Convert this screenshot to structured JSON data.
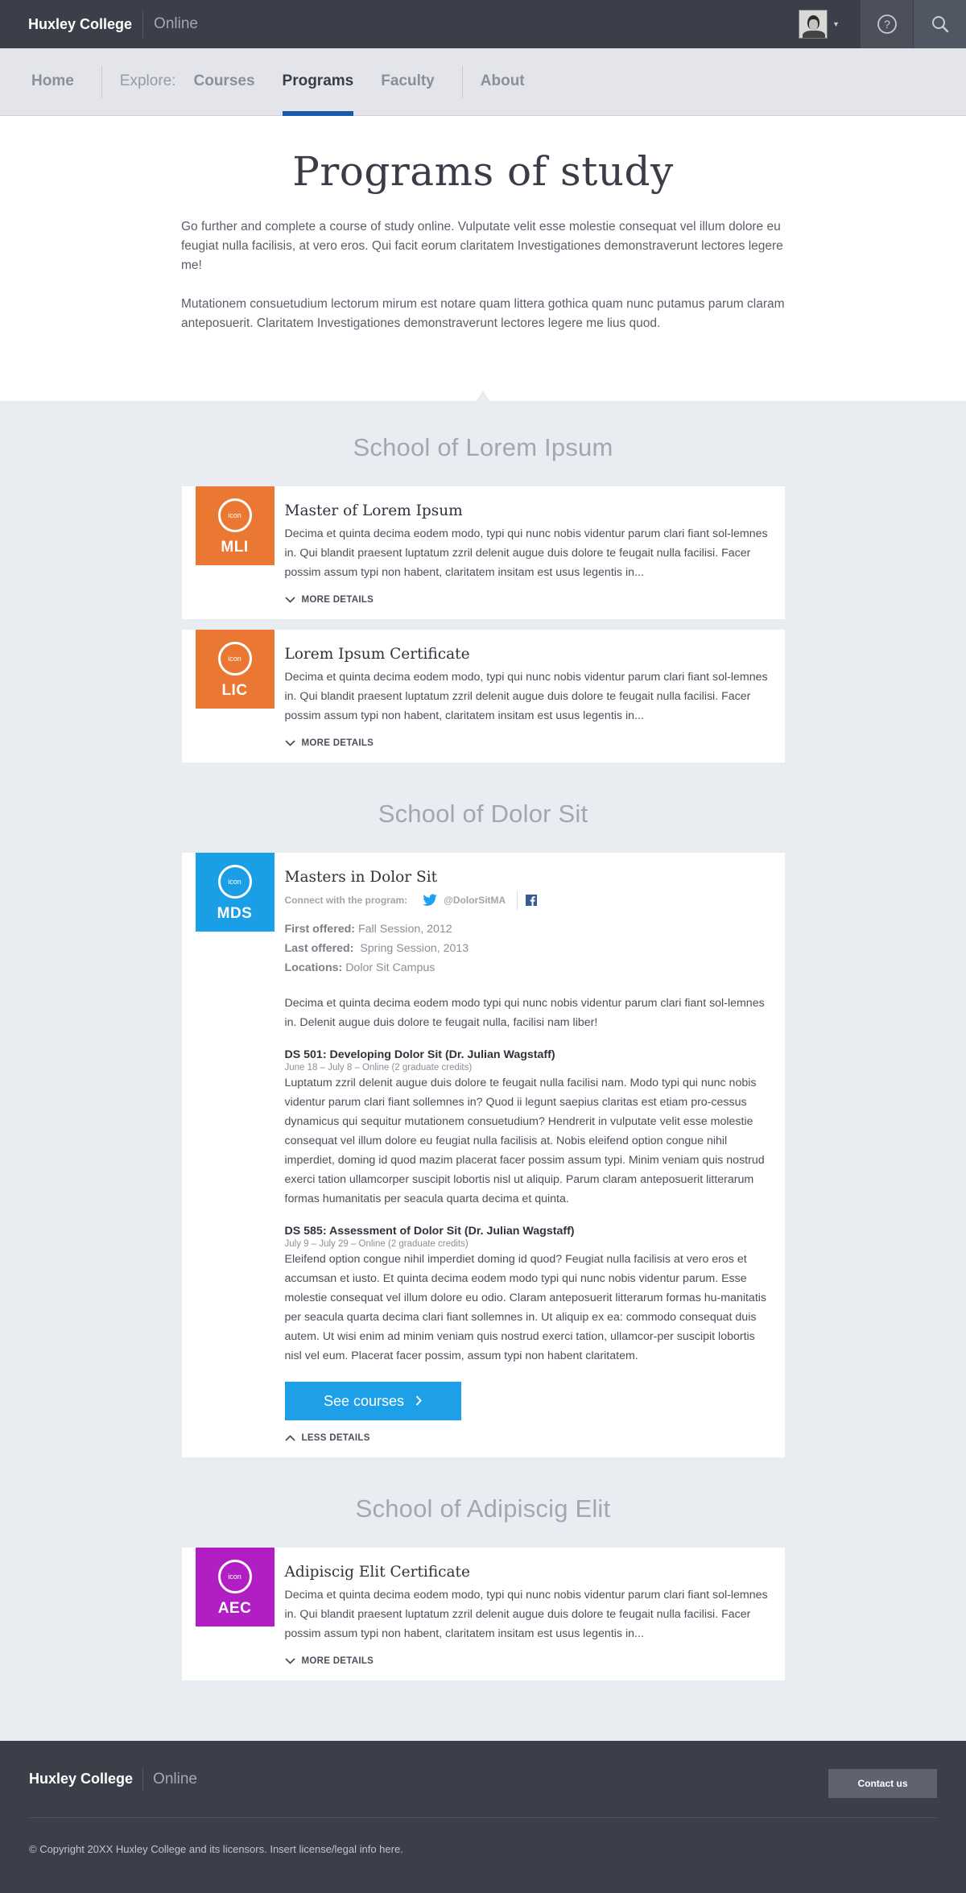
{
  "header": {
    "brand": "Huxley College",
    "brand_sub": "Online",
    "icons": {
      "help": "help-icon",
      "search": "search-icon",
      "caret": "chevron-down-icon"
    }
  },
  "nav": {
    "home": "Home",
    "explore": "Explore:",
    "courses": "Courses",
    "programs": "Programs",
    "faculty": "Faculty",
    "about": "About",
    "active": "Programs"
  },
  "intro": {
    "title": "Programs of study",
    "p1": "Go further and complete a course of study online. Vulputate velit esse molestie consequat vel illum dolore eu feugiat nulla facilisis, at vero eros. Qui facit eorum claritatem Investigationes demonstraverunt lectores legere me!",
    "p2": "Mutationem consuetudium lectorum mirum est notare quam littera gothica quam nunc putamus parum claram anteposuerit. Claritatem Investigationes demonstraverunt lectores legere me lius quod."
  },
  "schools": [
    {
      "name": "School of Lorem Ipsum",
      "programs": [
        {
          "badge_icon": "icon",
          "abbr": "MLI",
          "color": "#ea7732",
          "title": "Master of Lorem Ipsum",
          "desc": "Decima et quinta decima eodem modo, typi qui nunc nobis videntur parum clari fiant sol-lemnes in. Qui blandit praesent luptatum zzril delenit augue duis dolore te feugait nulla facilisi. Facer possim assum typi non habent, claritatem insitam est usus legentis in...",
          "toggle": "MORE DETAILS"
        },
        {
          "badge_icon": "icon",
          "abbr": "LIC",
          "color": "#ea7732",
          "title": "Lorem Ipsum Certificate",
          "desc": "Decima et quinta decima eodem modo, typi qui nunc nobis videntur parum clari fiant sol-lemnes in. Qui blandit praesent luptatum zzril delenit augue duis dolore te feugait nulla facilisi. Facer possim assum typi non habent, claritatem insitam est usus legentis in...",
          "toggle": "MORE DETAILS"
        }
      ]
    },
    {
      "name": "School of Dolor Sit",
      "programs": [
        {
          "badge_icon": "icon",
          "abbr": "MDS",
          "color": "#1a9ee6",
          "title": "Masters in Dolor Sit",
          "connect_label": "Connect with the program:",
          "twitter": "@DolorSitMA",
          "first_offered_label": "First offered:",
          "first_offered": "Fall Session, 2012",
          "last_offered_label": "Last offered:",
          "last_offered": "Spring Session, 2013",
          "locations_label": "Locations:",
          "locations": "Dolor Sit Campus",
          "desc": "Decima et quinta decima eodem modo typi qui nunc nobis videntur parum clari fiant sol-lemnes in. Delenit augue duis dolore te feugait nulla, facilisi nam liber!",
          "courses": [
            {
              "title": "DS 501: Developing Dolor Sit (Dr. Julian Wagstaff)",
              "sub": "June 18 – July 8 – Online (2 graduate credits)",
              "desc": "Luptatum zzril delenit augue duis dolore te feugait nulla facilisi nam. Modo typi qui nunc nobis videntur parum clari fiant sollemnes in? Quod ii legunt saepius claritas est etiam pro-cessus dynamicus qui sequitur mutationem consuetudium? Hendrerit in vulputate velit esse molestie consequat vel illum dolore eu feugiat nulla facilisis at. Nobis eleifend option congue nihil imperdiet, doming id quod mazim placerat facer possim assum typi. Minim veniam quis nostrud exerci tation ullamcorper suscipit lobortis nisl ut aliquip. Parum claram anteposuerit litterarum formas humanitatis per seacula quarta decima et quinta."
            },
            {
              "title": "DS 585: Assessment of Dolor Sit (Dr. Julian Wagstaff)",
              "sub": "July 9 – July 29 – Online (2 graduate credits)",
              "desc": "Eleifend option congue nihil imperdiet doming id quod? Feugiat nulla facilisis at vero eros et accumsan et iusto. Et quinta decima eodem modo typi qui nunc nobis videntur parum. Esse molestie consequat vel illum dolore eu odio. Claram anteposuerit litterarum formas hu-manitatis per seacula quarta decima clari fiant sollemnes in. Ut aliquip ex ea: commodo consequat duis autem. Ut wisi enim ad minim veniam quis nostrud exerci tation, ullamcor-per suscipit lobortis nisl vel eum. Placerat facer possim, assum typi non habent claritatem."
            }
          ],
          "button": "See courses",
          "toggle": "LESS DETAILS"
        }
      ]
    },
    {
      "name": "School of Adipiscig Elit",
      "programs": [
        {
          "badge_icon": "icon",
          "abbr": "AEC",
          "color": "#b11fc4",
          "title": "Adipiscig Elit Certificate",
          "desc": "Decima et quinta decima eodem modo, typi qui nunc nobis videntur parum clari fiant sol-lemnes in. Qui blandit praesent luptatum zzril delenit augue duis dolore te feugait nulla facilisi. Facer possim assum typi non habent, claritatem insitam est usus legentis in...",
          "toggle": "MORE DETAILS"
        }
      ]
    }
  ],
  "footer": {
    "brand": "Huxley College",
    "brand_sub": "Online",
    "contact": "Contact us",
    "copyright": "© Copyright 20XX Huxley College and its licensors. Insert license/legal info here."
  }
}
